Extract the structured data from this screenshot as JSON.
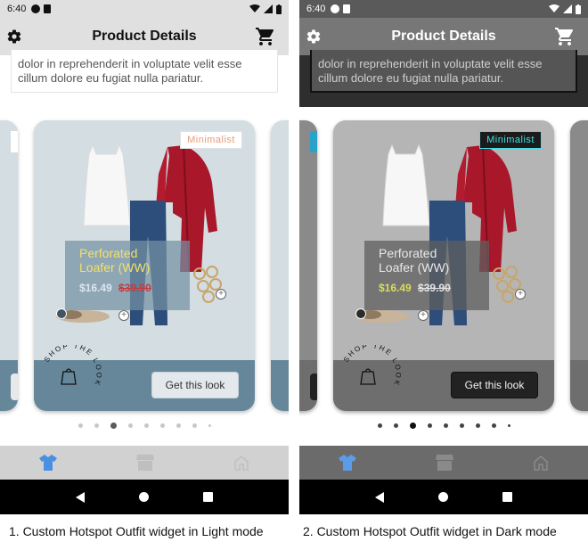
{
  "status_bar": {
    "time": "6:40"
  },
  "app_bar": {
    "title": "Product Details",
    "left_icon": "gear-icon",
    "right_icon": "cart-icon"
  },
  "description": {
    "text": "dolor in reprehenderit in voluptate velit esse cillum dolore eu fugiat nulla pariatur."
  },
  "card": {
    "tag": "Minimalist",
    "product_name": "Perforated Loafer (WW)",
    "price": "$16.49",
    "old_price": "$39.90",
    "badge_text": "SHOP THE LOOK",
    "cta": "Get this look"
  },
  "carousel": {
    "page_count": 9,
    "active_index": 2
  },
  "bottom_nav": {
    "items": [
      "shirt-icon",
      "store-icon",
      "home-icon"
    ],
    "active": "shirt-icon"
  },
  "colors": {
    "light_accent": "#66879a",
    "dark_tag": "#3fe0e6",
    "active_nav": "#4a90e2"
  },
  "captions": {
    "light": "1. Custom Hotspot Outfit widget in Light mode",
    "dark": "2. Custom Hotspot Outfit widget in Dark mode"
  }
}
